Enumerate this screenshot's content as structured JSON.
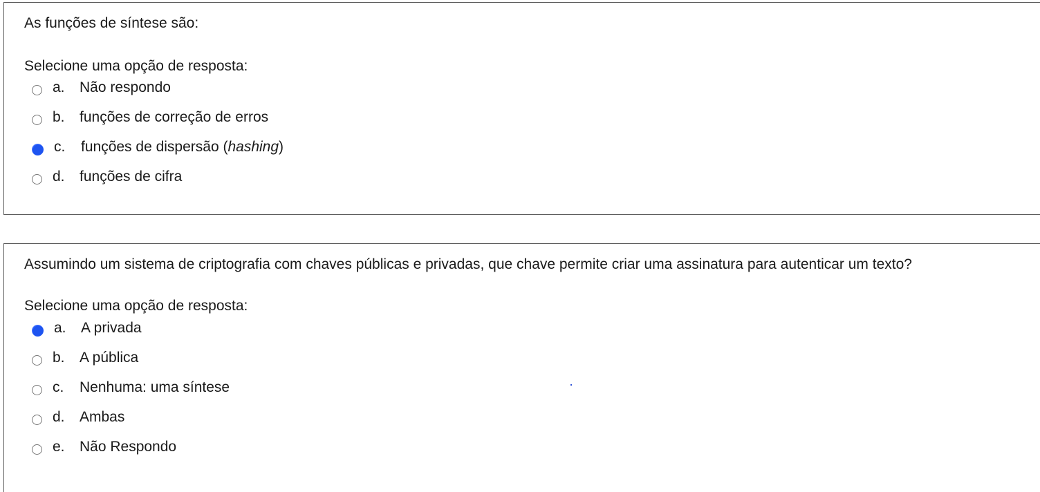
{
  "questions": [
    {
      "text": "As funções de síntese são:",
      "prompt": "Selecione uma opção de resposta:",
      "options": [
        {
          "letter": "a.",
          "label": "Não respondo",
          "selected": false
        },
        {
          "letter": "b.",
          "label": "funções de correção de erros",
          "selected": false
        },
        {
          "letter": "c.",
          "label_prefix": "funções de dispersão (",
          "label_italic": "hashing",
          "label_suffix": ")",
          "selected": true
        },
        {
          "letter": "d.",
          "label": "funções de cifra",
          "selected": false
        }
      ]
    },
    {
      "text": "Assumindo um sistema de criptografia com chaves públicas e privadas, que chave permite criar uma assinatura para autenticar um texto?",
      "prompt": "Selecione uma opção de resposta:",
      "options": [
        {
          "letter": "a.",
          "label": "A privada",
          "selected": true
        },
        {
          "letter": "b.",
          "label": "A pública",
          "selected": false
        },
        {
          "letter": "c.",
          "label": "Nenhuma: uma síntese",
          "selected": false
        },
        {
          "letter": "d.",
          "label": "Ambas",
          "selected": false
        },
        {
          "letter": "e.",
          "label": "Não Respondo",
          "selected": false
        }
      ]
    }
  ],
  "colors": {
    "radio_selected": "#1e54f0",
    "border": "#5a5a5a"
  }
}
